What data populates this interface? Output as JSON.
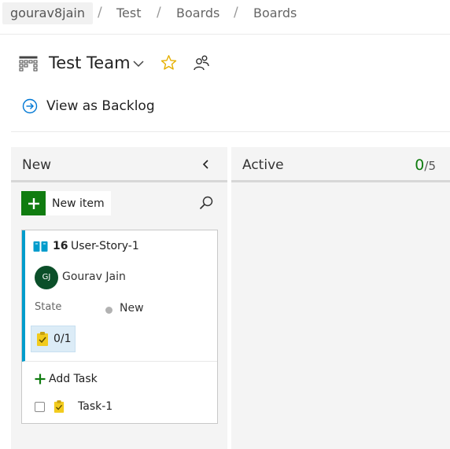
{
  "breadcrumb": {
    "items": [
      "gourav8jain",
      "Test",
      "Boards",
      "Boards"
    ],
    "separator": "/"
  },
  "header": {
    "team_name": "Test Team",
    "icons": [
      "board-grid-icon",
      "chevron-down-icon",
      "star-icon",
      "team-members-icon"
    ]
  },
  "backlog_link": {
    "label": "View as Backlog",
    "icon": "arrow-circle-icon"
  },
  "columns": [
    {
      "title": "New",
      "collapse_icon": "chevron-left-icon",
      "new_item_label": "New item",
      "cards": [
        {
          "id": "16",
          "title": "User-Story-1",
          "type_icon": "user-story-book-icon",
          "accent_color": "#009ccc",
          "assignee_initials": "GJ",
          "assignee": "Gourav Jain",
          "state_label": "State",
          "state_value": "New",
          "task_progress": "0/1",
          "add_task_label": "Add Task",
          "tasks": [
            {
              "title": "Task-1",
              "done": false
            }
          ]
        }
      ]
    },
    {
      "title": "Active",
      "wip_current": "0",
      "wip_limit": "/5"
    }
  ],
  "colors": {
    "accent_green": "#107c10",
    "story_blue": "#009ccc",
    "star_gold": "#e6b000",
    "task_yellow": "#f2cb1d",
    "avatar_green": "#0b4f29"
  }
}
